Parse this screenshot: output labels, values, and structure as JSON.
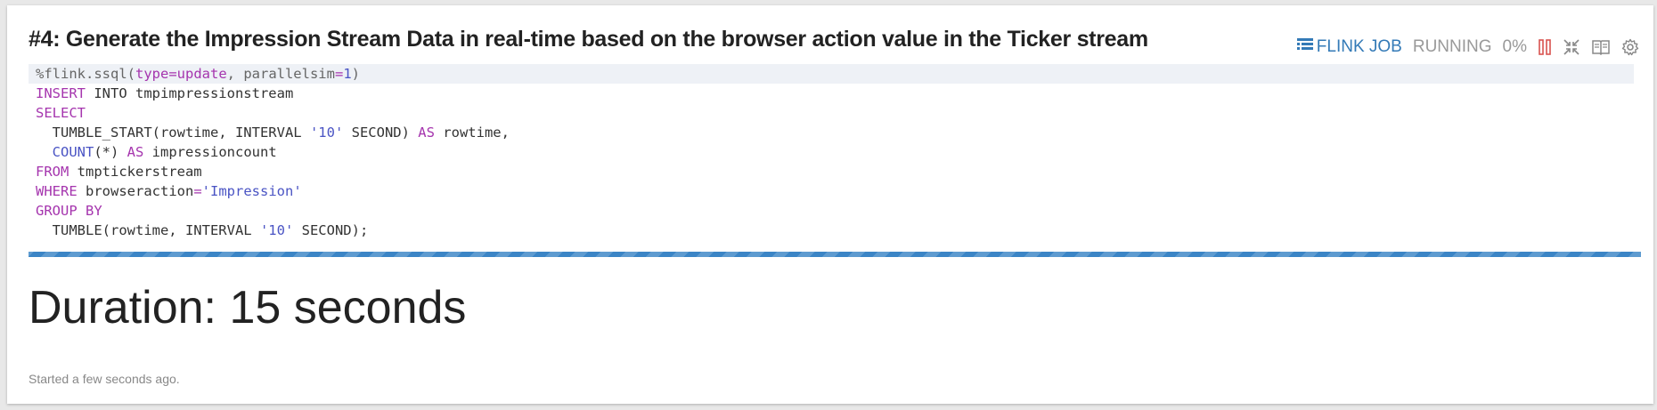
{
  "paragraph": {
    "title": "#4: Generate the Impression Stream Data in real-time based on the browser action value in the Ticker stream",
    "job_label": "FLINK JOB",
    "status": "RUNNING",
    "progress": "0%",
    "progress_fraction": 0.0
  },
  "code": {
    "lines": [
      {
        "t1": "%flink.ssql(",
        "t2": "type",
        "t3": "=",
        "t4": "update",
        "t5": ", parallelsim",
        "t6": "=",
        "t7": "1",
        "t8": ")"
      },
      {
        "kw": "INSERT",
        "rest": " INTO tmpimpressionstream"
      },
      {
        "kw": "SELECT"
      },
      {
        "pre": "  TUMBLE_START(rowtime, INTERVAL ",
        "str": "'10'",
        "mid": " SECOND) ",
        "kw": "AS",
        "rest": " rowtime,"
      },
      {
        "pre": "  ",
        "fn": "COUNT",
        "mid": "(*) ",
        "kw": "AS",
        "rest": " impressioncount"
      },
      {
        "kw": "FROM",
        "rest": " tmptickerstream"
      },
      {
        "kw": "WHERE",
        "mid": " browseraction",
        "op": "=",
        "str": "'Impression'"
      },
      {
        "kw": "GROUP BY"
      },
      {
        "pre": "  TUMBLE(rowtime, INTERVAL ",
        "str": "'10'",
        "rest": " SECOND);"
      }
    ]
  },
  "result": {
    "duration": "Duration: 15 seconds",
    "started": "Started a few seconds ago."
  },
  "colors": {
    "accent": "#337ab7",
    "keyword": "#a535ae",
    "string": "#4a54c4",
    "stop_icon": "#d9534f",
    "progress_bar": "#3b85c6"
  },
  "icons": [
    "flink-job-icon",
    "stop-icon",
    "collapse-icon",
    "book-icon",
    "gear-icon"
  ]
}
